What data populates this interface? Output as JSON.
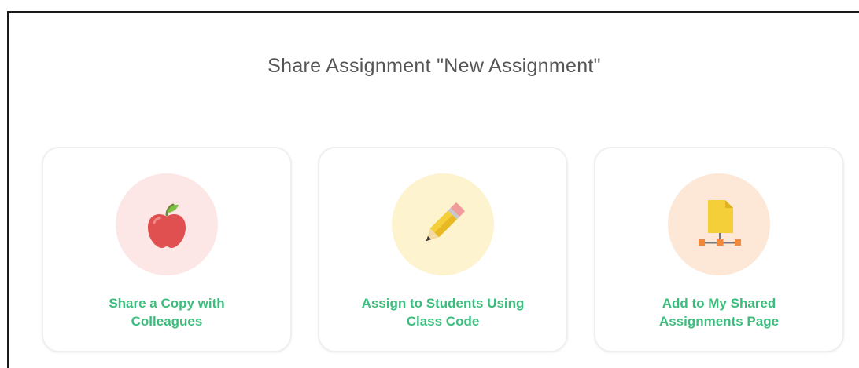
{
  "dialog": {
    "title": "Share Assignment \"New Assignment\""
  },
  "options": [
    {
      "label_line1": "Share a Copy with",
      "label_line2": "Colleagues",
      "icon": "apple-icon",
      "circle_color": "#fde6e6"
    },
    {
      "label_line1": "Assign to Students Using",
      "label_line2": "Class Code",
      "icon": "pencil-icon",
      "circle_color": "#fdf3cf"
    },
    {
      "label_line1": "Add to My Shared",
      "label_line2": "Assignments Page",
      "icon": "shared-document-network-icon",
      "circle_color": "#fde7d6"
    }
  ],
  "colors": {
    "accent_green": "#3dbd7d",
    "title_gray": "#555555"
  }
}
